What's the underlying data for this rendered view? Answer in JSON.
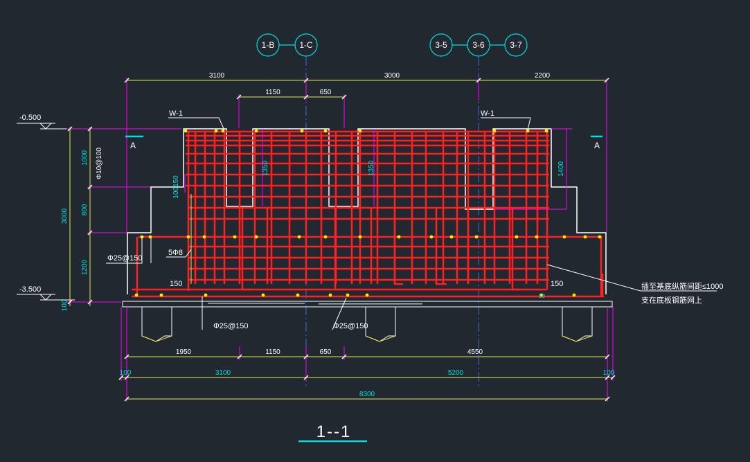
{
  "drawing": {
    "title": "1--1",
    "axes_top": [
      "1-B",
      "1-C",
      "3-5",
      "3-6",
      "3-7"
    ],
    "section_marks": [
      "A",
      "A"
    ],
    "elevations": [
      "-0.500",
      "-3.500"
    ],
    "wall_labels": [
      "W-1",
      "W-1"
    ],
    "dims_top": [
      "3100",
      "3000",
      "2200"
    ],
    "dims_top_inner": [
      "1150",
      "650"
    ],
    "dims_left": [
      "1000",
      "800",
      "1200",
      "3000",
      "100"
    ],
    "dim_bottom_1": [
      "1950",
      "1150",
      "650",
      "4550"
    ],
    "dim_bottom_2": [
      "100",
      "3100",
      "5200",
      "100"
    ],
    "dim_total": "8300",
    "vertical_dims": [
      "1350",
      "1350",
      "1400",
      "100150"
    ],
    "rebar_labels": {
      "stirrup": "Φ10@100",
      "side_bars": "Φ25@150",
      "bars_count": "5Φ8",
      "left_150": "150",
      "right_150": "150",
      "bottom_1": "Φ25@150",
      "bottom_2": "Φ25@150",
      "small_dim": "50"
    },
    "note_lines": [
      "插至基底纵筋间距≤1000",
      "支在底板钢筋网上"
    ],
    "colors": {
      "background": "#212830",
      "rebar": "#ff2020",
      "outline": "#ffffff",
      "dimension": "#ff00ff",
      "axis_circle": "#00e0e0",
      "dim_line": "#e8e84a",
      "bar_dot": "#ffee00"
    }
  }
}
